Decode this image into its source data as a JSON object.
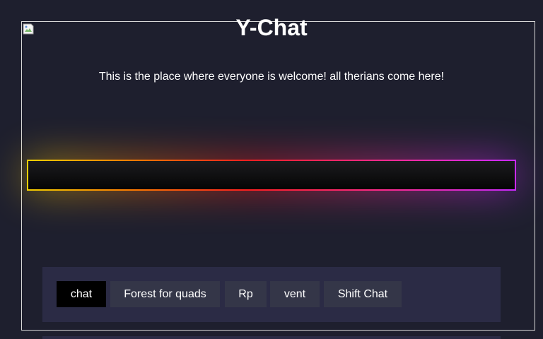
{
  "header": {
    "title": "Y-Chat",
    "subtitle": "This is the place where everyone is welcome! all therians come here!"
  },
  "tabs": [
    {
      "label": "chat",
      "active": true
    },
    {
      "label": "Forest for quads",
      "active": false
    },
    {
      "label": "Rp",
      "active": false
    },
    {
      "label": "vent",
      "active": false
    },
    {
      "label": "Shift Chat",
      "active": false
    }
  ],
  "colors": {
    "background": "#1e1f2e",
    "panel": "#2b2b45",
    "tab": "#343648",
    "active_tab": "#000000",
    "bar_gradient": [
      "#f5d100",
      "#ff7a00",
      "#ff1f1f",
      "#ff2a8a",
      "#c92aff"
    ]
  },
  "icons": {
    "banner": "broken-image-icon"
  }
}
